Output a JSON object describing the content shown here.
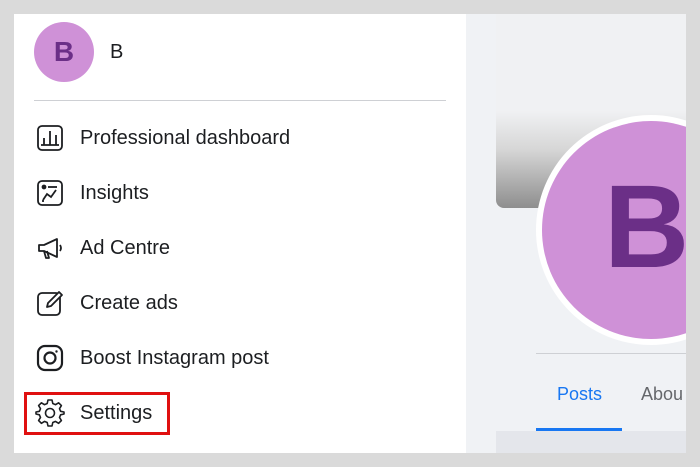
{
  "profile": {
    "avatar_letter": "B",
    "name": "B"
  },
  "menu": {
    "items": [
      {
        "label": "Professional dashboard",
        "icon": "dashboard-icon"
      },
      {
        "label": "Insights",
        "icon": "insights-icon"
      },
      {
        "label": "Ad Centre",
        "icon": "megaphone-icon"
      },
      {
        "label": "Create ads",
        "icon": "pencil-icon"
      },
      {
        "label": "Boost Instagram post",
        "icon": "instagram-icon"
      },
      {
        "label": "Settings",
        "icon": "gear-icon"
      }
    ]
  },
  "page_profile": {
    "avatar_letter": "B"
  },
  "tabs": [
    {
      "label": "Posts",
      "active": true
    },
    {
      "label": "Abou",
      "active": false
    }
  ],
  "colors": {
    "avatar_bg": "#cf91d7",
    "avatar_letter": "#6b2f87",
    "accent": "#1877f2",
    "highlight_border": "#e01010"
  }
}
